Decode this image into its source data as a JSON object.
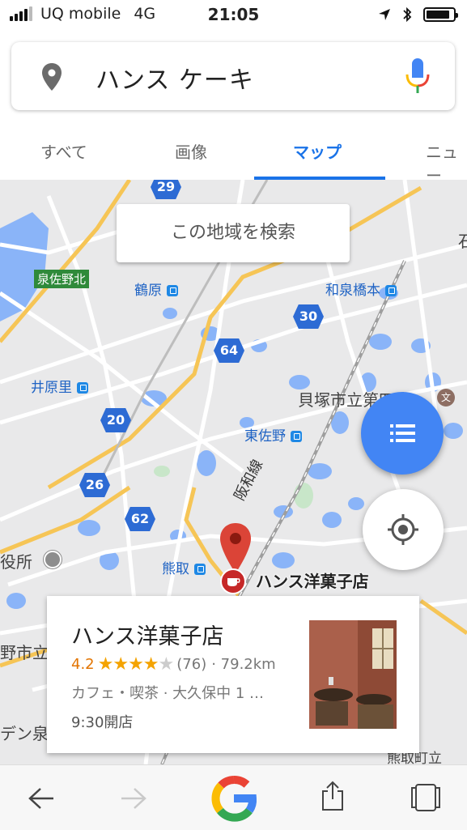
{
  "status_bar": {
    "carrier": "UQ mobile",
    "network": "4G",
    "time": "21:05"
  },
  "search": {
    "query": "ハンス ケーキ"
  },
  "tabs": [
    {
      "label": "すべて",
      "active": false
    },
    {
      "label": "画像",
      "active": false
    },
    {
      "label": "マップ",
      "active": true
    },
    {
      "label": "ニュー",
      "active": false
    }
  ],
  "map": {
    "search_area_button": "この地域を検索",
    "labels": {
      "izumisano_kita": "泉佐野北",
      "tsuruhara": "鶴原",
      "izumi_hashimoto": "和泉橋本",
      "ihara_sato": "井原里",
      "kaizuka": "貝塚市立第四中",
      "higashi_sano": "東佐野",
      "kumatori": "熊取",
      "yakusho": "役所",
      "noshiritsu": "野市立",
      "den": "デン泉",
      "kumatori_town": "熊取町立",
      "ishi": "石",
      "hanwa_line": "阪和線"
    },
    "routes": [
      "29",
      "30",
      "64",
      "20",
      "26",
      "62"
    ],
    "place_marker_label": "ハンス洋菓子店"
  },
  "place_card": {
    "name": "ハンス洋菓子店",
    "rating": "4.2",
    "stars_filled": 4,
    "stars_total": 5,
    "review_count": "(76)",
    "distance": "· 79.2km",
    "category": "カフェ・喫茶 · 大久保中 1 …",
    "hours": "9:30開店"
  },
  "colors": {
    "accent": "#1a73e8",
    "fab": "#4285f4",
    "marker": "#db4437",
    "route_badge": "#2d6bd4"
  },
  "toolbar": {
    "icons": [
      "back-icon",
      "forward-icon",
      "google-logo-icon",
      "share-icon",
      "tabs-icon"
    ]
  }
}
